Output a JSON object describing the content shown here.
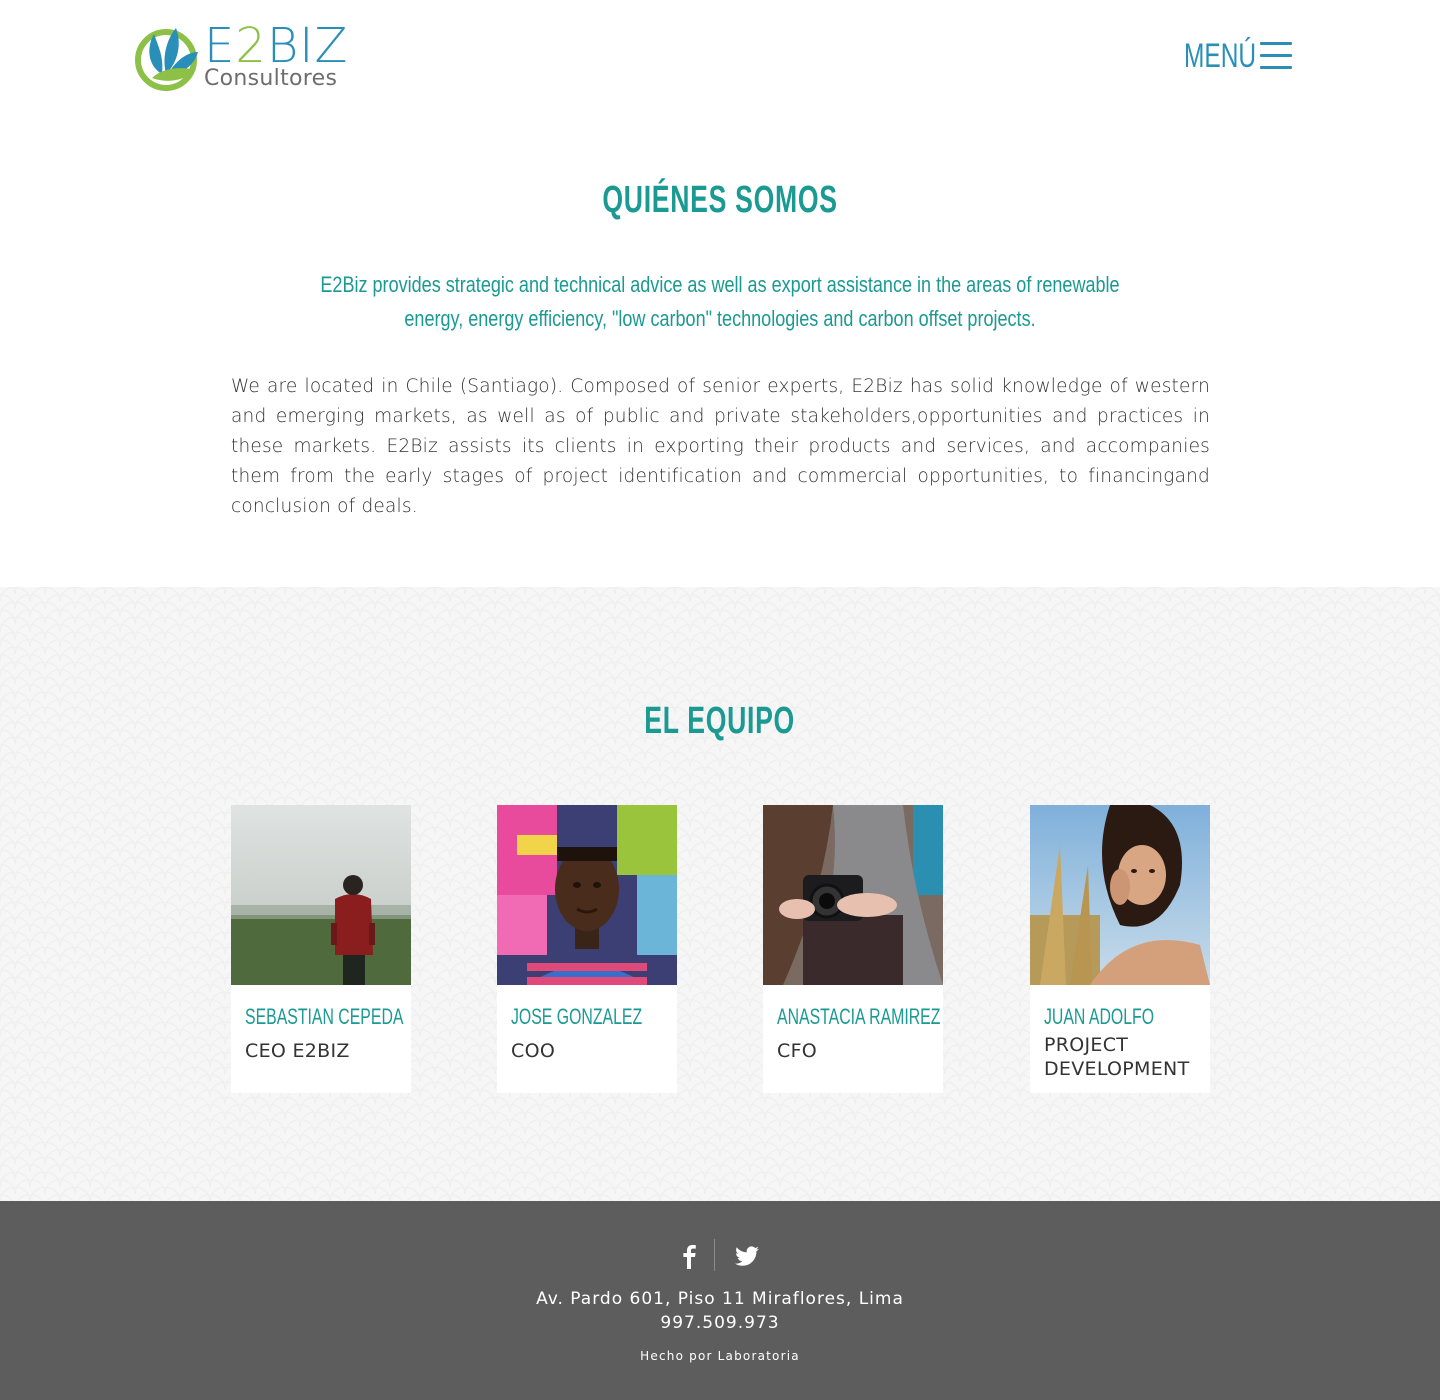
{
  "brand": {
    "name_part1": "E",
    "name_two": "2",
    "name_part2": "BIZ",
    "subtitle": "Consultores",
    "colors": {
      "blue": "#2a8fb8",
      "green": "#8cc046",
      "teal": "#1a9a92"
    }
  },
  "header": {
    "menu_label": "MENÚ",
    "menu_icon": "hamburger-icon"
  },
  "about": {
    "title": "QUIÉNES SOMOS",
    "lead": "E2Biz provides strategic and technical advice as well as export assistance in the areas of renewable energy, energy efficiency, \"low carbon\" technologies and carbon offset projects.",
    "body": "We are located in Chile (Santiago). Composed of senior experts, E2Biz has solid knowledge of western and emerging markets, as well as of public and private stakeholders,opportunities and practices in these markets. E2Biz assists its clients in exporting their products and services, and accompanies them from the early stages of project identification and commercial opportunities, to financingand conclusion of deals."
  },
  "team": {
    "title": "EL EQUIPO",
    "members": [
      {
        "name": "SEBASTIAN CEPEDA",
        "role": "CEO E2BIZ"
      },
      {
        "name": "JOSE GONZALEZ",
        "role": "COO"
      },
      {
        "name": "ANASTACIA RAMIREZ",
        "role": "CFO"
      },
      {
        "name": "JUAN ADOLFO",
        "role": "PROJECT DEVELOPMENT"
      }
    ]
  },
  "footer": {
    "social": [
      "facebook-icon",
      "twitter-icon"
    ],
    "address": "Av. Pardo 601, Piso 11 Miraflores, Lima",
    "phone": "997.509.973",
    "credit": "Hecho por Laboratoria"
  }
}
